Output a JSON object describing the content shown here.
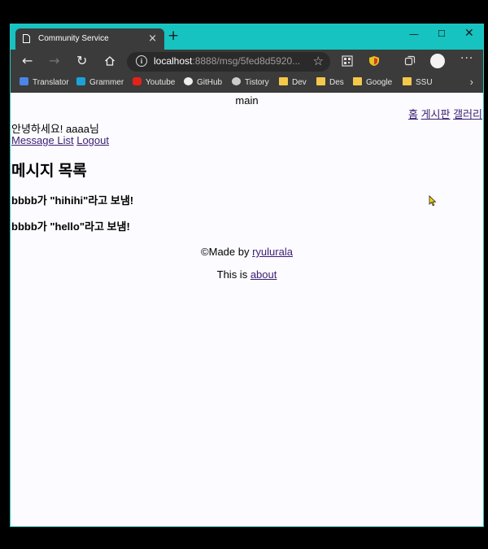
{
  "browser": {
    "tab_title": "Community Service",
    "new_tab": "+",
    "url_host": "localhost",
    "url_rest": ":8888/msg/5fed8d5920..."
  },
  "bookmarks": [
    "Translator",
    "Grammer",
    "Youtube",
    "GitHub",
    "Tistory",
    "Dev",
    "Des",
    "Google",
    "SSU"
  ],
  "page": {
    "header": "main",
    "nav": {
      "home": "홈",
      "board": "게시판",
      "gallery": "갤러리"
    },
    "greeting": "안녕하세요! aaaa님",
    "links": {
      "message_list": "Message List",
      "logout": "Logout"
    },
    "heading": "메시지 목록",
    "messages": [
      "bbbb가 \"hihihi\"라고 보냄!",
      "bbbb가 \"hello\"라고 보냄!"
    ],
    "footer": {
      "made_by": "©Made by ",
      "author": "ryulurala",
      "this_is": "This is ",
      "about": "about"
    }
  }
}
